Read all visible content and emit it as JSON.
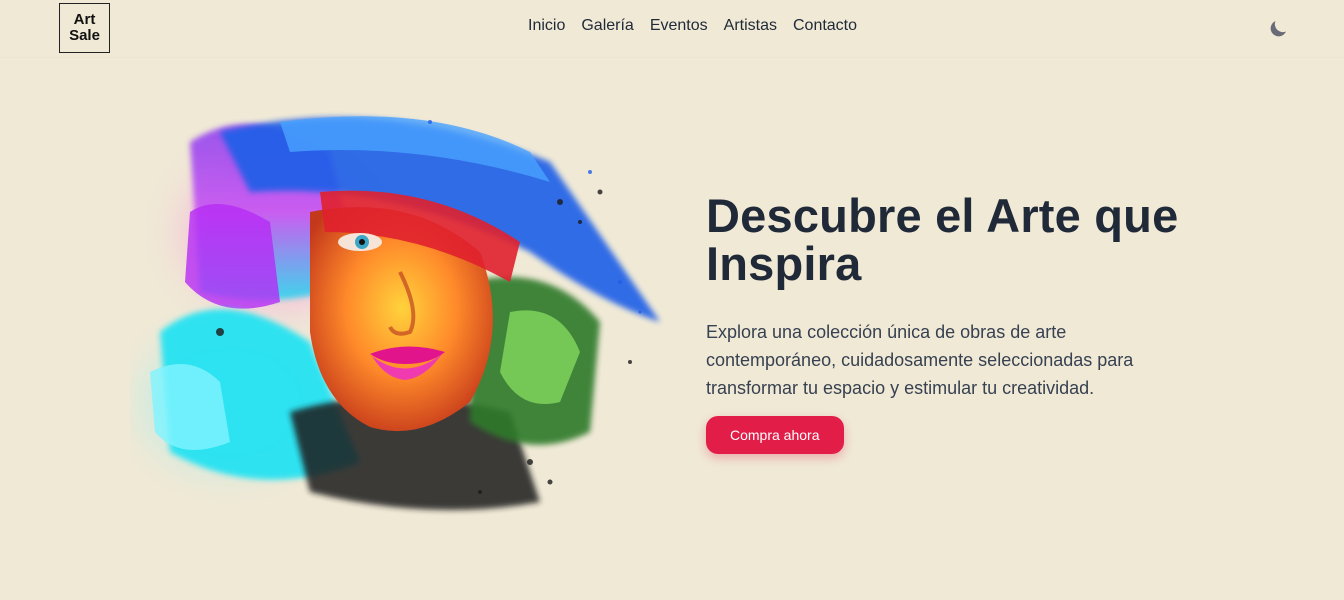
{
  "brand": {
    "line1": "Art",
    "line2": "Sale"
  },
  "nav": {
    "items": [
      {
        "label": "Inicio"
      },
      {
        "label": "Galería"
      },
      {
        "label": "Eventos"
      },
      {
        "label": "Artistas"
      },
      {
        "label": "Contacto"
      }
    ],
    "theme_toggle_icon": "moon-icon"
  },
  "hero": {
    "image_icon": "abstract-painted-face-artwork",
    "title": "Descubre el Arte que Inspira",
    "description": "Explora una colección única de obras de arte contemporáneo, cuidadosamente seleccionadas para transformar tu espacio y estimular tu creatividad.",
    "cta_label": "Compra ahora"
  },
  "colors": {
    "background": "#f0e9d6",
    "accent": "#e11d48",
    "text": "#1f2937"
  }
}
